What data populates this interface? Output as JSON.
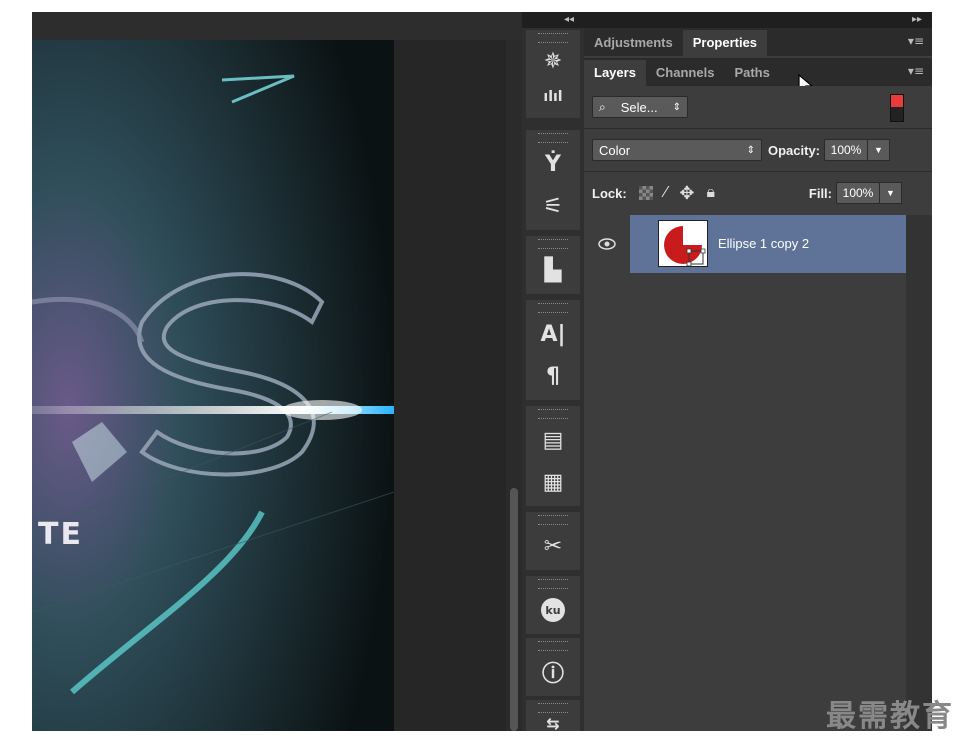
{
  "dock": {
    "collapse_glyph": "◂◂",
    "icons": [
      {
        "name": "navigator-icon",
        "glyph": "✵"
      },
      {
        "name": "histogram-icon",
        "glyph": "ılıl"
      },
      {
        "name": "brush-presets-icon",
        "glyph": "Ẏ"
      },
      {
        "name": "tool-presets-icon",
        "glyph": "⚟"
      },
      {
        "name": "clone-source-icon",
        "glyph": "▙"
      },
      {
        "name": "character-icon",
        "glyph": "A|"
      },
      {
        "name": "paragraph-icon",
        "glyph": "¶"
      },
      {
        "name": "character-styles-icon",
        "glyph": "▤"
      },
      {
        "name": "paragraph-styles-icon",
        "glyph": "▦"
      },
      {
        "name": "tools-icon",
        "glyph": "✂"
      },
      {
        "name": "kuler-icon",
        "glyph": "ku"
      },
      {
        "name": "info-icon",
        "glyph": "ⓘ"
      },
      {
        "name": "history-icon",
        "glyph": "⇆"
      }
    ]
  },
  "panel": {
    "expand_glyph": "▸▸",
    "menu_glyph": "▾≡",
    "top_tabs": [
      "Adjustments",
      "Properties"
    ],
    "active_top_tab": "Properties",
    "layer_tabs": [
      "Layers",
      "Channels",
      "Paths"
    ],
    "active_layer_tab": "Layers",
    "filter_label": "Sele...",
    "blend_mode": "Color",
    "opacity_label": "Opacity:",
    "opacity_value": "100%",
    "lock_label": "Lock:",
    "fill_label": "Fill:",
    "fill_value": "100%",
    "layers": [
      {
        "name": "Ellipse 1 copy 2",
        "visible": true,
        "thumb_color": "#c81c1c"
      }
    ]
  },
  "canvas": {
    "artwork_text": "TE"
  },
  "watermark": "最需教育"
}
